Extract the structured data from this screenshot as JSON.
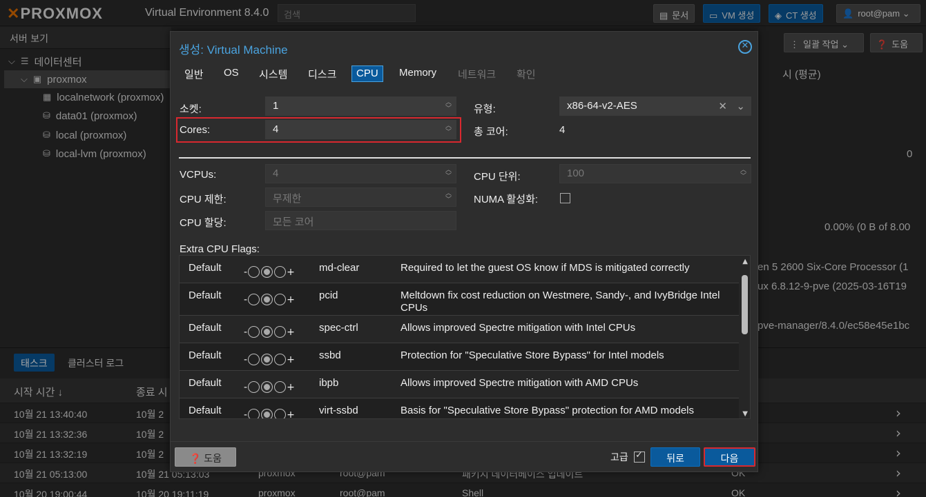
{
  "app": {
    "logo_text": "PROXMOX",
    "title": "Virtual Environment 8.4.0",
    "search_placeholder": "검색"
  },
  "topbar": {
    "docs_label": "문서",
    "create_vm_label": "VM 생성",
    "create_ct_label": "CT 생성",
    "user_label": "root@pam"
  },
  "left": {
    "view_label": "서버 보기",
    "tree": [
      {
        "label": "데이터센터"
      },
      {
        "label": "proxmox"
      },
      {
        "label": "localnetwork (proxmox)"
      },
      {
        "label": "data01 (proxmox)"
      },
      {
        "label": "local (proxmox)"
      },
      {
        "label": "local-lvm (proxmox)"
      }
    ]
  },
  "right_bg": {
    "bulk_action_label": "일괄 작업",
    "help_label": "도움",
    "time_select": "시 (평균)",
    "zero": "0",
    "usage": "0.00% (0 B of 8.00",
    "cpu_model": "en 5 2600 Six-Core Processor (1",
    "kernel": "ux 6.8.12-9-pve (2025-03-16T19",
    "pve_manager": "pve-manager/8.4.0/ec58e45e1bc"
  },
  "bottom": {
    "tabs": [
      "태스크",
      "클러스터 로그"
    ],
    "columns": [
      "시작 시간 ↓",
      "종료 시"
    ],
    "rows": [
      {
        "start": "10월 21 13:40:40",
        "end": "10월 2",
        "node": "",
        "user": "",
        "desc": "",
        "status": ""
      },
      {
        "start": "10월 21 13:32:36",
        "end": "10월 2",
        "node": "",
        "user": "",
        "desc": "",
        "status": ""
      },
      {
        "start": "10월 21 13:32:19",
        "end": "10월 2",
        "node": "",
        "user": "",
        "desc": "",
        "status": ""
      },
      {
        "start": "10월 21 05:13:00",
        "end": "10월 21 05:13:03",
        "node": "proxmox",
        "user": "root@pam",
        "desc": "패키지 데이터베이스 업데이트",
        "status": "OK"
      },
      {
        "start": "10월 20 19:00:44",
        "end": "10월 20 19:11:19",
        "node": "proxmox",
        "user": "root@pam",
        "desc": "Shell",
        "status": "OK"
      }
    ]
  },
  "modal": {
    "title_prefix": "생성:",
    "title": "Virtual Machine",
    "tabs": [
      {
        "label": "일반",
        "state": "normal"
      },
      {
        "label": "OS",
        "state": "normal"
      },
      {
        "label": "시스템",
        "state": "normal"
      },
      {
        "label": "디스크",
        "state": "normal"
      },
      {
        "label": "CPU",
        "state": "active"
      },
      {
        "label": "Memory",
        "state": "normal"
      },
      {
        "label": "네트워크",
        "state": "disabled"
      },
      {
        "label": "확인",
        "state": "disabled"
      }
    ],
    "fields": {
      "sockets_label": "소켓:",
      "sockets_value": "1",
      "cores_label": "Cores:",
      "cores_value": "4",
      "type_label": "유형:",
      "type_value": "x86-64-v2-AES",
      "total_cores_label": "총 코어:",
      "total_cores_value": "4",
      "vcpus_label": "VCPUs:",
      "vcpus_value": "4",
      "cpu_units_label": "CPU 단위:",
      "cpu_units_value": "100",
      "cpu_limit_label": "CPU 제한:",
      "cpu_limit_value": "무제한",
      "numa_label": "NUMA 활성화:",
      "cpu_affinity_label": "CPU 할당:",
      "cpu_affinity_value": "모든 코어",
      "extra_flags_label": "Extra CPU Flags:"
    },
    "flags": [
      {
        "default": "Default",
        "name": "md-clear",
        "desc": "Required to let the guest OS know if MDS is mitigated correctly"
      },
      {
        "default": "Default",
        "name": "pcid",
        "desc": "Meltdown fix cost reduction on Westmere, Sandy-, and IvyBridge Intel CPUs"
      },
      {
        "default": "Default",
        "name": "spec-ctrl",
        "desc": "Allows improved Spectre mitigation with Intel CPUs"
      },
      {
        "default": "Default",
        "name": "ssbd",
        "desc": "Protection for \"Speculative Store Bypass\" for Intel models"
      },
      {
        "default": "Default",
        "name": "ibpb",
        "desc": "Allows improved Spectre mitigation with AMD CPUs"
      },
      {
        "default": "Default",
        "name": "virt-ssbd",
        "desc": "Basis for \"Speculative Store Bypass\" protection for AMD models"
      }
    ],
    "radio_minus": "-",
    "radio_plus": "+",
    "footer": {
      "help_label": "도움",
      "advanced_label": "고급",
      "back_label": "뒤로",
      "next_label": "다음"
    }
  }
}
